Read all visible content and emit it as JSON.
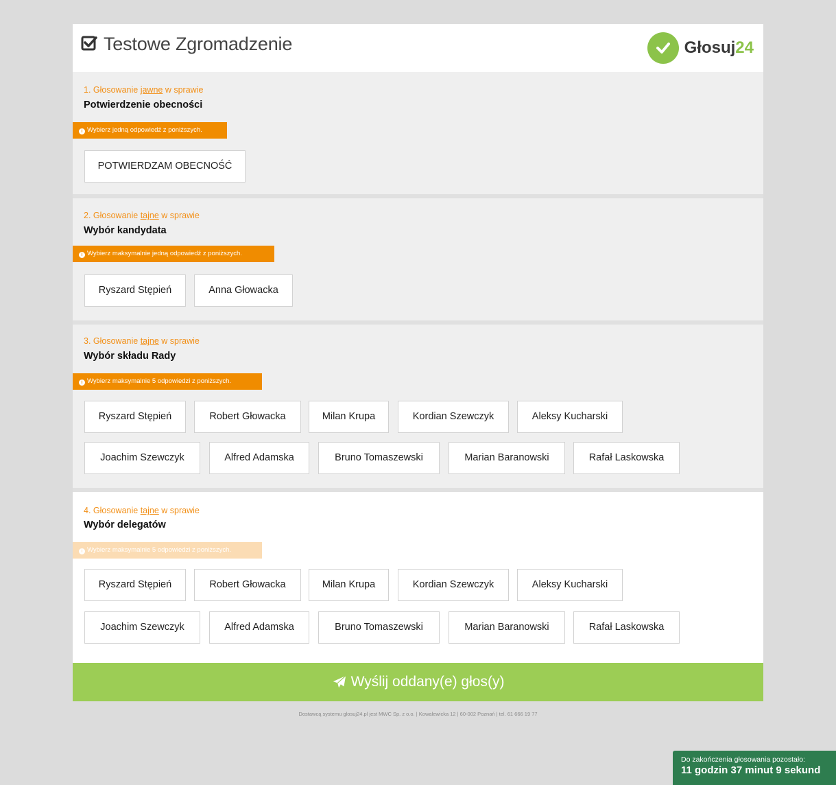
{
  "header": {
    "title": "Testowe Zgromadzenie",
    "logo_text": "Głosuj",
    "logo_number": "24"
  },
  "sections": [
    {
      "label_prefix": "1. Głosowanie ",
      "label_type": "jawne",
      "label_suffix": " w sprawie",
      "title": "Potwierdzenie obecności",
      "hint": "Wybierz jedną odpowiedź z poniższych.",
      "options": [
        "POTWIERDZAM OBECNOŚĆ"
      ]
    },
    {
      "label_prefix": "2. Głosowanie ",
      "label_type": "tajne",
      "label_suffix": " w sprawie",
      "title": "Wybór kandydata",
      "hint": "Wybierz maksymalnie jedną odpowiedź z poniższych.",
      "options": [
        "Ryszard Stępień",
        "Anna Głowacka"
      ]
    },
    {
      "label_prefix": "3. Głosowanie ",
      "label_type": "tajne",
      "label_suffix": " w sprawie",
      "title": "Wybór składu Rady",
      "hint": "Wybierz maksymalnie 5 odpowiedzi z poniższych.",
      "options": [
        "Ryszard Stępień",
        "Robert Głowacka",
        "Milan Krupa",
        "Kordian Szewczyk",
        "Aleksy Kucharski",
        "Joachim Szewczyk",
        "Alfred Adamska",
        "Bruno Tomaszewski",
        "Marian Baranowski",
        "Rafał Laskowska"
      ]
    },
    {
      "label_prefix": "4. Głosowanie ",
      "label_type": "tajne",
      "label_suffix": " w sprawie",
      "title": "Wybór delegatów",
      "hint": "Wybierz maksymalnie 5 odpowiedzi z poniższych.",
      "options": [
        "Ryszard Stępień",
        "Robert Głowacka",
        "Milan Krupa",
        "Kordian Szewczyk",
        "Aleksy Kucharski",
        "Joachim Szewczyk",
        "Alfred Adamska",
        "Bruno Tomaszewski",
        "Marian Baranowski",
        "Rafał Laskowska"
      ]
    }
  ],
  "submit_label": "Wyślij oddany(e) głos(y)",
  "footer": "Dostawcą systemu glosuj24.pl jest MWC Sp. z o.o. | Kowalewicka 12 | 60-002 Poznań | tel. 61 666 19 77",
  "timer": {
    "label": "Do zakończenia głosowania pozostało:",
    "value": "11 godzin 37 minut 9 sekund"
  },
  "colors": {
    "accent_orange": "#f08c00",
    "brand_green": "#8cc34a",
    "submit_green": "#9ccd55",
    "timer_green": "#2e7d4f"
  },
  "icons": {
    "title": "checkbox-checked-icon",
    "logo": "check-circle-icon",
    "hint": "info-circle-icon",
    "submit": "paper-plane-icon"
  }
}
